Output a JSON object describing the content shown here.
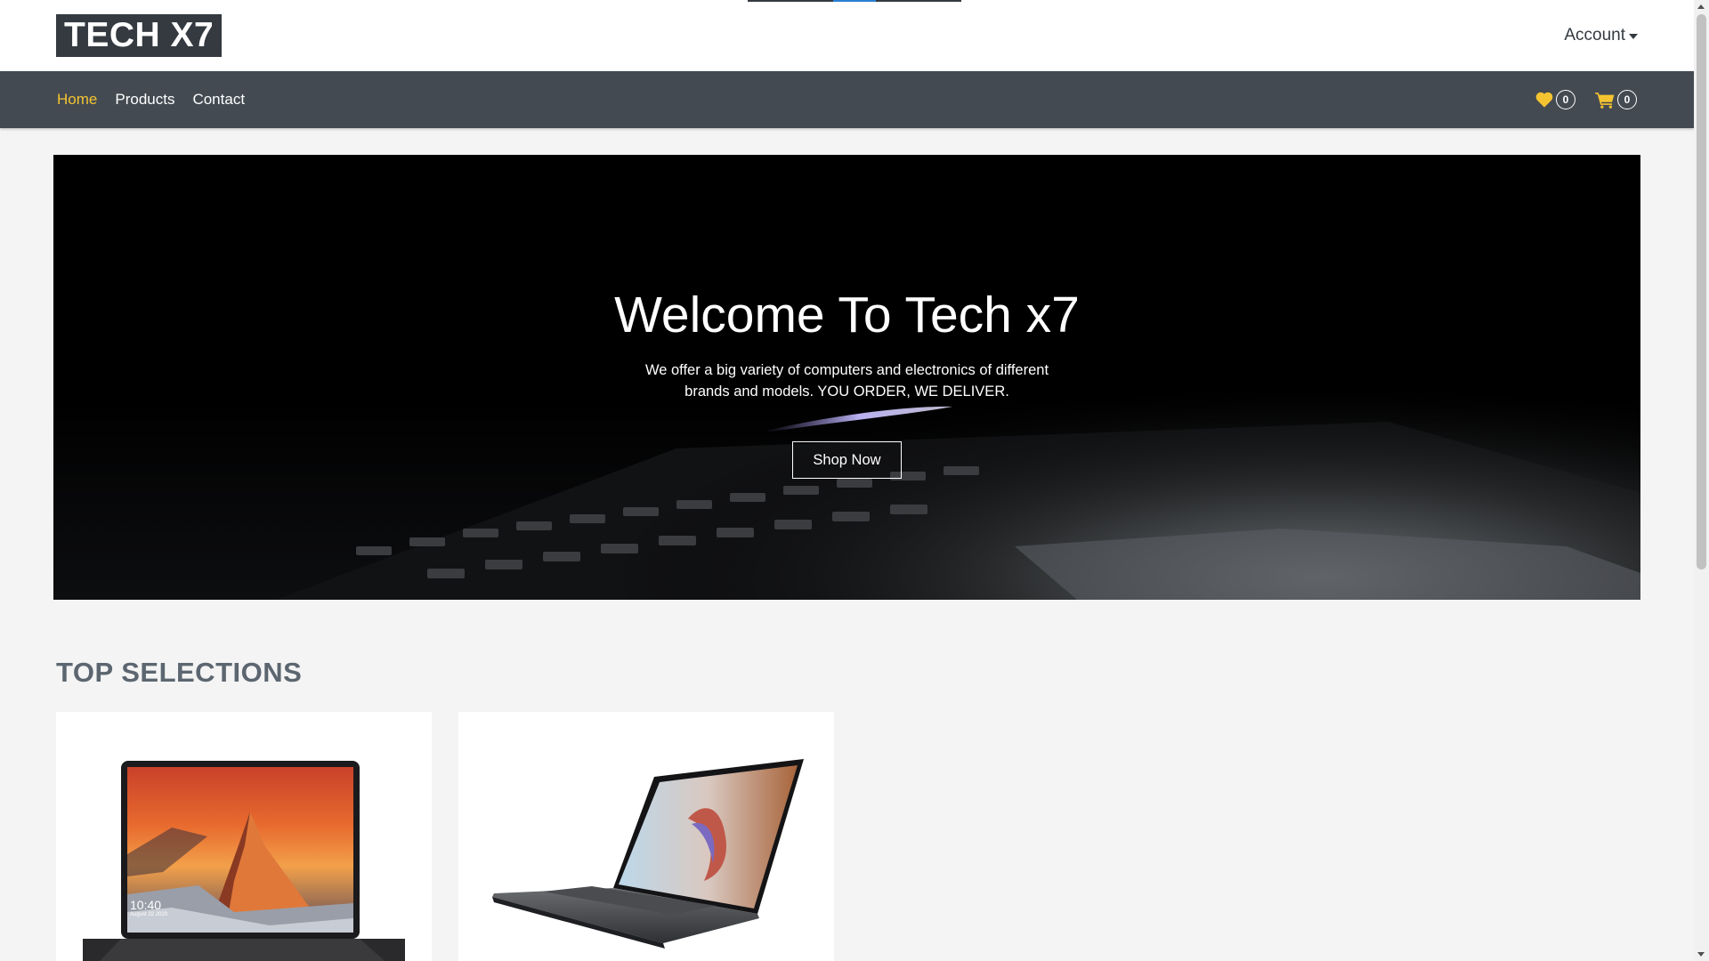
{
  "header": {
    "brand": "TECH X7",
    "account_label": "Account"
  },
  "nav": {
    "links": [
      {
        "label": "Home",
        "active": true
      },
      {
        "label": "Products",
        "active": false
      },
      {
        "label": "Contact",
        "active": false
      }
    ],
    "wishlist": {
      "icon": "heart-icon",
      "count": "0"
    },
    "cart": {
      "icon": "cart-icon",
      "count": "0"
    }
  },
  "hero": {
    "title": "Welcome To Tech x7",
    "text": "We offer a big variety of computers and electronics of different brands and models. YOU ORDER, WE DELIVER.",
    "button": "Shop Now"
  },
  "sections": {
    "top_selections": {
      "title": "TOP SELECTIONS",
      "products": [
        {
          "image": "laptop-mountain-wallpaper",
          "clock": "10:40",
          "date": "August 22 2020"
        },
        {
          "image": "laptop-abstract-wallpaper"
        }
      ]
    }
  },
  "colors": {
    "accent": "#f4c430",
    "navbar": "#434a52",
    "brand_bg": "#343a40",
    "page_bg": "#f4f4f4"
  }
}
